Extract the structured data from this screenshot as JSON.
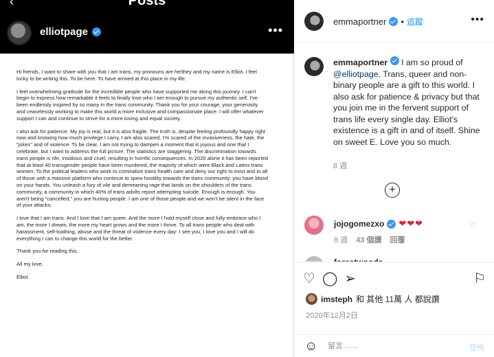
{
  "left": {
    "posts_title": "Posts",
    "back_arrow": "‹",
    "inner_username": "elliotpage",
    "inner_more": "•••",
    "letter": [
      "Hi friends, I want to share with you that I am trans, my pronouns are he/they and my name is Elliot. I feel lucky to be writing this. To be here. To have arrived at this place in my life.",
      "I feel overwhelming gratitude for the incredible people who have supported me along this journey. I can't begin to express how remarkable it feels to finally love who I am enough to pursue my authentic self. I've been endlessly inspired by so many in the trans community. Thank you for your courage, your generosity and ceaselessly working to make this world a more inclusive and compassionate place. I will offer whatever support I can and continue to strive for a more loving and equal society.",
      "I also ask for patience. My joy is real, but it is also fragile. The truth is, despite feeling profoundly happy right now and knowing how much privilege I carry, I am also scared. I'm scared of the invasiveness, the hate, the \"jokes\" and of violence. To be clear, I am not trying to dampen a moment that is joyous and one that I celebrate, but I want to address the full picture. The statistics are staggering. The discrimination towards trans people is rife, insidious and cruel, resulting in horrific consequences. In 2020 alone it has been reported that at least 40 transgender people have been murdered, the majority of which were Black and Latinx trans women. To the political leaders who work to criminalize trans health care and deny our right to exist and to all of those with a massive platform who continue to spew hostility towards the trans community: you have blood on your hands. You unleash a fury of vile and demeaning rage that lands on the shoulders of the trans community, a community in which 40% of trans adults report attempting suicide. Enough is enough. You aren't being \"cancelled,\" you are hurting people. I am one of those people and we won't be silent in the face of your attacks.",
      "I love that I am trans. And I love that I am queer. And the more I hold myself close and fully embrace who I am, the more I dream, the more my heart grows and the more I thrive. To all trans people who deal with harassment, self-loathing, abuse and the threat of violence every day: I see you, I love you and I will do everything I can to change this world for the better.",
      "Thank you for reading this.",
      "All my love,",
      "Elliot"
    ]
  },
  "right": {
    "header": {
      "username": "emmaportner",
      "separator": "•",
      "follow_label": "追蹤",
      "more": "•••"
    },
    "caption": {
      "username": "emmaportner",
      "text_before": " I am so proud of ",
      "mention": "@elliotpage",
      "text_after": ". Trans, queer and non-binary people are a gift to this world. I also ask for patience & privacy but that you join me in the fervent support of trans life every single day. Elliot's existence is a gift in and of itself. Shine on sweet E. Love you so much.",
      "time": "8 週"
    },
    "load_more": "+",
    "comment": {
      "username": "jojogomezxo",
      "hearts": "❤❤❤",
      "time": "8 週",
      "likes": "43 個讚",
      "reply": "回覆",
      "like_icon": "♡"
    },
    "next_comment": {
      "username": "forestwoods"
    },
    "actions": {
      "like_icon": "♡",
      "comment_icon": "◯",
      "share_icon": "➢",
      "bookmark_icon": "⚐",
      "liked_by_user": "imsteph",
      "liked_by_rest": "和 其他 11萬 人 都說讚",
      "date": "2020年12月2日"
    },
    "comment_box": {
      "emoji_icon": "☺",
      "placeholder": "留言……",
      "post_label": "發佈"
    }
  }
}
